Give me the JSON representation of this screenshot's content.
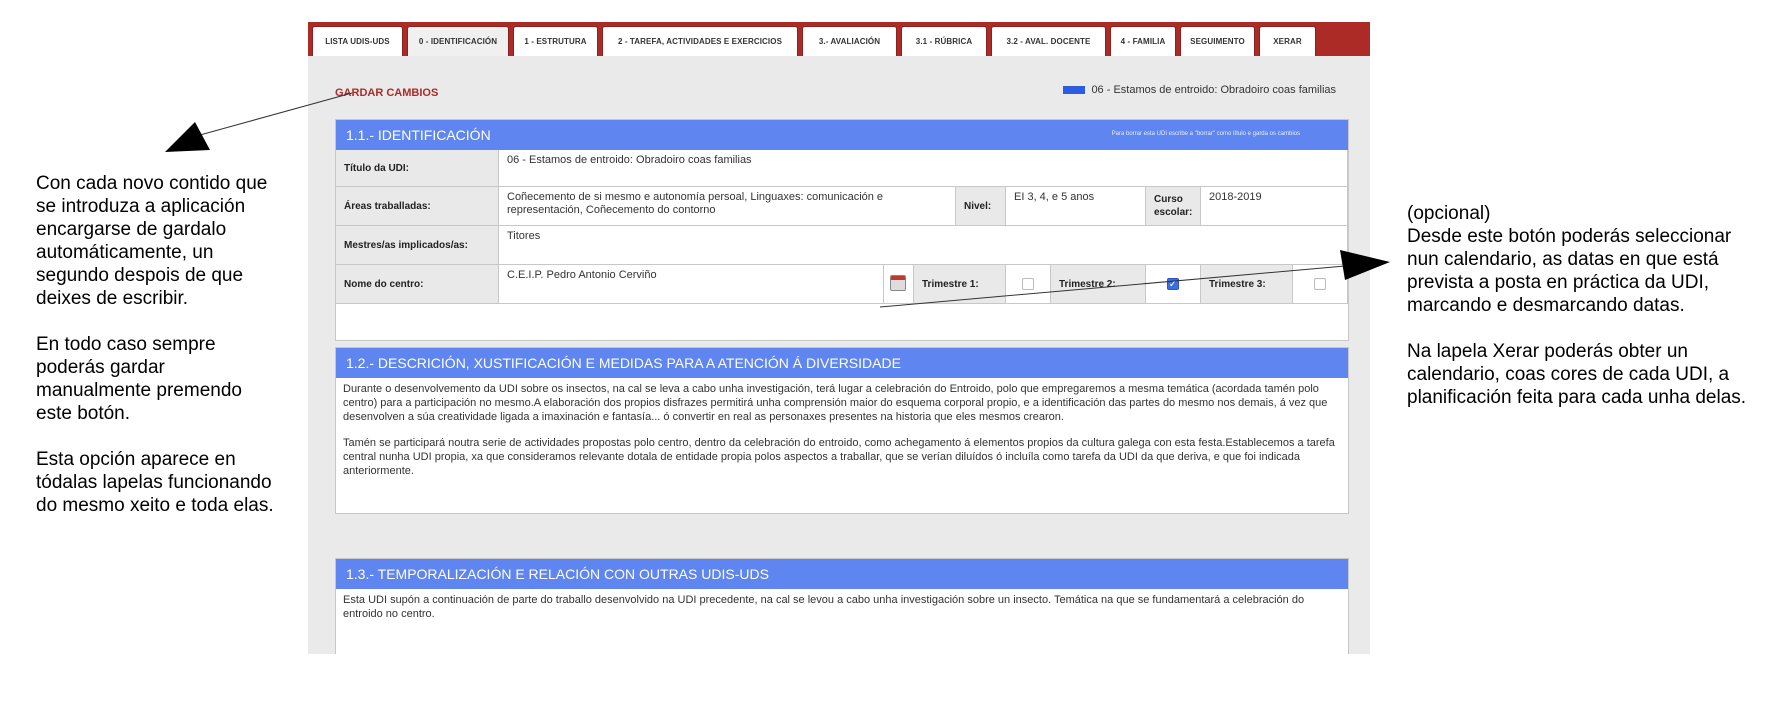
{
  "tabs": [
    {
      "label": "LISTA UDIS-UDS",
      "active": false
    },
    {
      "label": "0 - IDENTIFICACIÓN",
      "active": true
    },
    {
      "label": "1 - ESTRUTURA",
      "active": false
    },
    {
      "label": "2 - TAREFA, ACTIVIDADES E EXERCICIOS",
      "active": false
    },
    {
      "label": "3.- AVALIACIÓN",
      "active": false
    },
    {
      "label": "3.1 - RÚBRICA",
      "active": false
    },
    {
      "label": "3.2 - AVAL. DOCENTE",
      "active": false
    },
    {
      "label": "4 - FAMILIA",
      "active": false
    },
    {
      "label": "SEGUIMENTO",
      "active": false
    },
    {
      "label": "XERAR",
      "active": false
    }
  ],
  "toolbar": {
    "save_label": "GARDAR CAMBIOS",
    "current_udi": "06 - Estamos de entroido: Obradoiro coas familias",
    "current_udi_color": "#2b5de0"
  },
  "identification": {
    "title": "1.1.- IDENTIFICACIÓN",
    "hint": "Para borrar esta UDI escribe a \"borrar\" como título e garda os cambios",
    "fields": {
      "udi_title_label": "Título da UDI:",
      "udi_title_value": "06 - Estamos de entroido: Obradoiro coas familias",
      "areas_label": "Áreas traballadas:",
      "areas_value": "Coñecemento de si mesmo e autonomía persoal, Linguaxes: comunicación e representación, Coñecemento do contorno",
      "level_label": "Nivel:",
      "level_value": "EI 3, 4, e 5 anos",
      "school_year_label": "Curso escolar:",
      "school_year_value": "2018-2019",
      "teachers_label": "Mestres/as implicados/as:",
      "teachers_value": "Titores",
      "school_label": "Nome do centro:",
      "school_value": "C.E.I.P. Pedro Antonio Cerviño",
      "term1_label": "Trimestre 1:",
      "term1_checked": false,
      "term2_label": "Trimestre 2:",
      "term2_checked": true,
      "term3_label": "Trimestre 3:",
      "term3_checked": false
    }
  },
  "description": {
    "title": "1.2.- DESCRICIÓN, XUSTIFICACIÓN E MEDIDAS PARA A ATENCIÓN Á DIVERSIDADE",
    "paragraph1": "Durante o desenvolvemento da UDI sobre os insectos, na cal se leva a cabo unha investigación, terá lugar a celebración do Entroido, polo que empregaremos a mesma temática (acordada tamén polo centro) para a participación no mesmo.A elaboración dos propios disfrazes permitirá unha comprensión maior do esquema corporal propio, e a identificación das partes do mesmo nos demais, á vez que desenvolven a súa creatividade ligada a imaxinación e fantasía... ó convertir en real as personaxes presentes na historia que eles mesmos crearon.",
    "paragraph2": "Tamén se participará noutra serie de actividades propostas polo centro, dentro da celebración do entroido, como achegamento á elementos propios da cultura galega con esta festa.Establecemos a tarefa central nunha UDI propia, xa que consideramos relevante dotala de entidade propia polos aspectos a traballar, que se verían diluídos ó incluíla como tarefa da UDI da que deriva, e que foi indicada anteriormente."
  },
  "temporalization": {
    "title": "1.3.- TEMPORALIZACIÓN E RELACIÓN CON OUTRAS UDIS-UDS",
    "paragraph": "Esta UDI supón a continuación de parte do traballo desenvolvido na UDI precedente, na cal se levou a cabo unha investigación sobre un insecto. Temática na que se fundamentará a celebración do entroido no centro."
  },
  "annotations": {
    "left": {
      "p1": "Con cada novo contido que se introduza a aplicación encargarse de gardalo automáticamente, un segundo despois de que deixes de escribir.",
      "p2": "En todo caso sempre poderás gardar manualmente premendo este botón.",
      "p3": "Esta opción aparece en tódalas lapelas funcionando do mesmo xeito e toda elas."
    },
    "right": {
      "p1": "(opcional)",
      "p2": "Desde este botón poderás seleccionar nun calendario, as datas en que está prevista a posta en práctica da UDI, marcando e desmarcando datas.",
      "p3": "Na lapela Xerar poderás obter un calendario, coas cores de cada UDI, a planificación feita para cada unha delas."
    }
  }
}
